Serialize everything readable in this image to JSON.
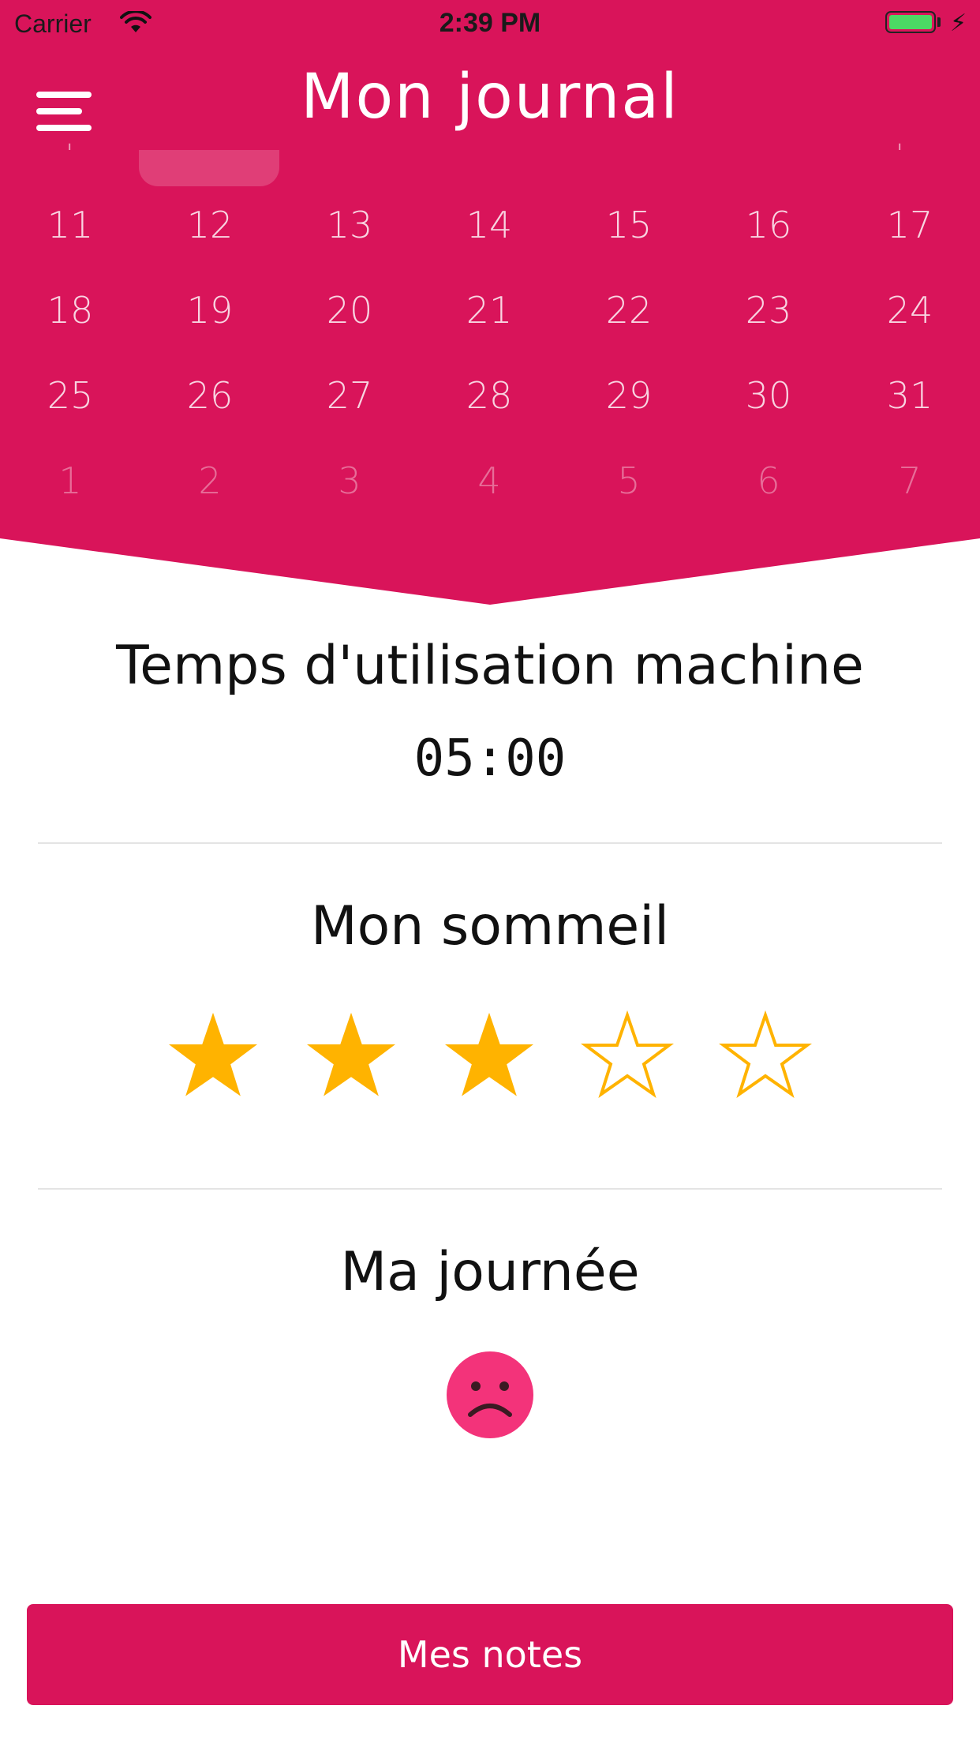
{
  "status_bar": {
    "carrier": "Carrier",
    "time": "2:39 PM"
  },
  "header": {
    "title": "Mon journal",
    "accent_color": "#d9145a",
    "menu_icon": "hamburger-menu-icon"
  },
  "calendar": {
    "rows": [
      [
        "11",
        "12",
        "13",
        "14",
        "15",
        "16",
        "17"
      ],
      [
        "18",
        "19",
        "20",
        "21",
        "22",
        "23",
        "24"
      ],
      [
        "25",
        "26",
        "27",
        "28",
        "29",
        "30",
        "31"
      ],
      [
        "1",
        "2",
        "3",
        "4",
        "5",
        "6",
        "7"
      ]
    ]
  },
  "machine_usage": {
    "title": "Temps d'utilisation machine",
    "value": "05:00"
  },
  "sleep": {
    "title": "Mon sommeil",
    "rating": 3,
    "max_rating": 5,
    "star_color": "#ffb300"
  },
  "day": {
    "title": "Ma journée",
    "mood_icon": "sad-face-icon",
    "mood_color": "#f3337a"
  },
  "notes_button": {
    "label": "Mes notes"
  }
}
